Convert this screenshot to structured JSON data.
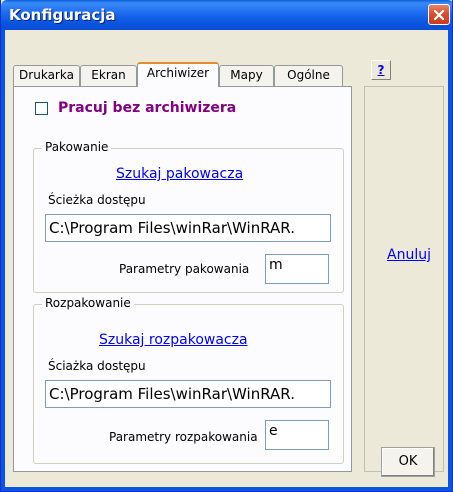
{
  "window": {
    "title": "Konfiguracja",
    "title_color": "#ffffff",
    "titlebar_color": "#0b55e1",
    "close_button_color": "#d8502f"
  },
  "tabs": [
    {
      "label": "Drukarka",
      "active": false
    },
    {
      "label": "Ekran",
      "active": false
    },
    {
      "label": "Archiwizer",
      "active": true
    },
    {
      "label": "Mapy",
      "active": false
    },
    {
      "label": "Ogólne",
      "active": false
    }
  ],
  "archiwizer": {
    "no_archiver_checkbox": {
      "label": "Pracuj bez archiwizera",
      "checked": false,
      "color": "#800080"
    },
    "packing": {
      "legend": "Pakowanie",
      "find_link": "Szukaj pakowacza",
      "path_label": "Ścieżka dostępu",
      "path_value": "C:\\Program Files\\winRar\\WinRAR.",
      "params_label": "Parametry pakowania",
      "params_value": "m"
    },
    "unpacking": {
      "legend": "Rozpakowanie",
      "find_link": "Szukaj rozpakowacza",
      "path_label": "Ściażka dostępu",
      "path_value": "C:\\Program Files\\winRar\\WinRAR.",
      "params_label": "Parametry rozpakowania",
      "params_value": "e"
    }
  },
  "buttons": {
    "help_label": "?",
    "cancel_label": "Anuluj",
    "ok_label": "OK",
    "link_color": "#0000ff"
  }
}
